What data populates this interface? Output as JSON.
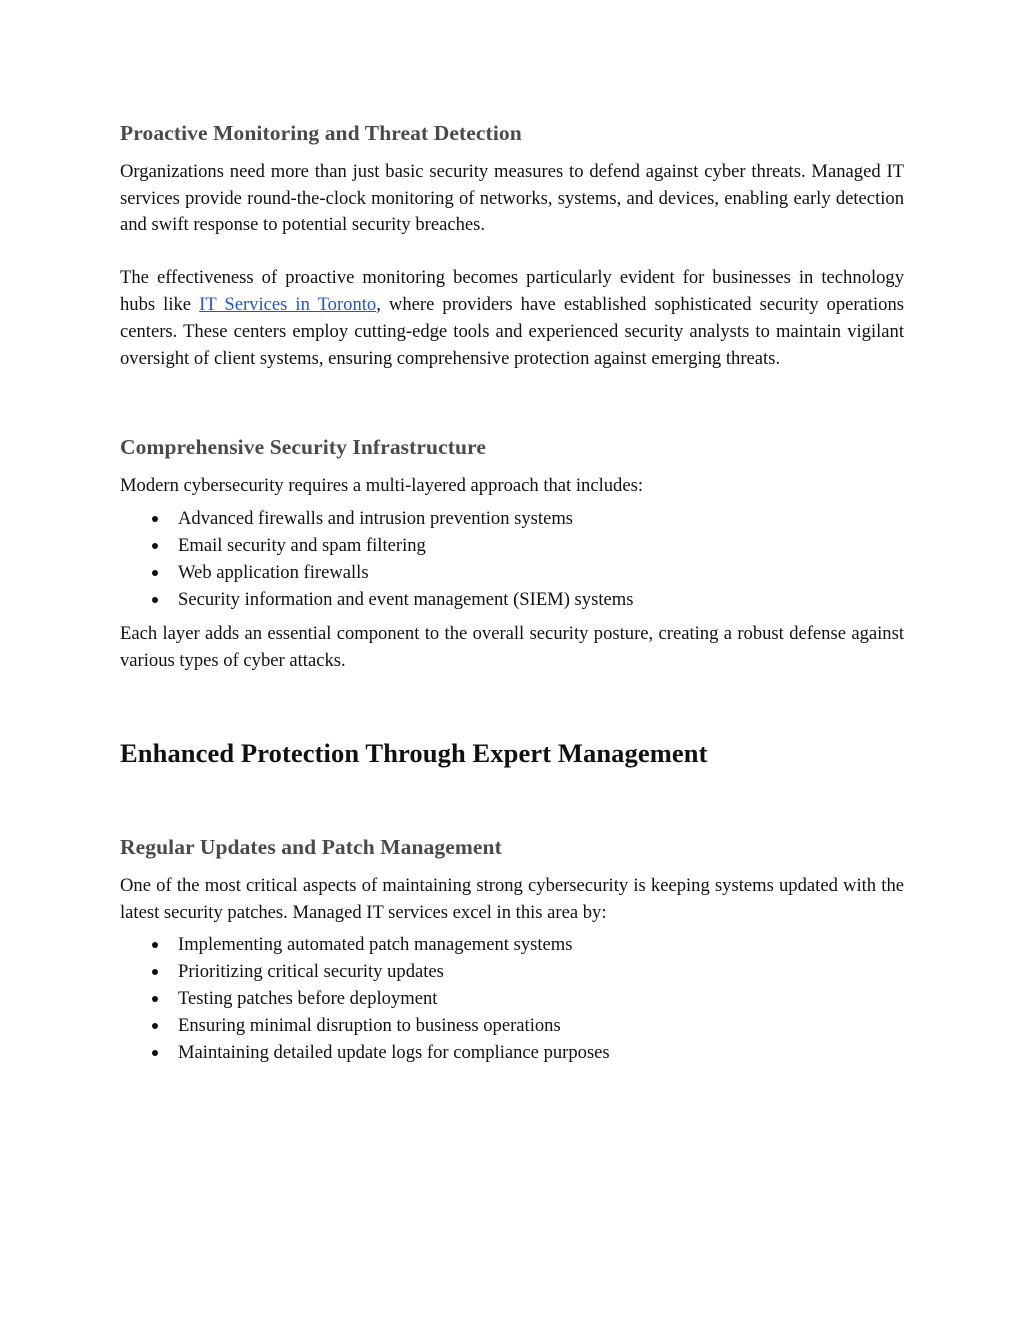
{
  "document": {
    "sections": [
      {
        "heading": "Proactive Monitoring and Threat Detection",
        "paragraph_1": "Organizations need more than just basic security measures to defend against cyber threats. Managed IT services provide round-the-clock monitoring of networks, systems, and devices, enabling early detection and swift response to potential security breaches.",
        "paragraph_2_before_link": "The effectiveness of proactive monitoring becomes particularly evident for businesses in technology hubs like ",
        "link_text": "IT Services in Toronto",
        "paragraph_2_after_link": ", where providers have established sophisticated security operations centers. These centers employ cutting-edge tools and experienced security analysts to maintain vigilant oversight of client systems, ensuring comprehensive protection against emerging threats."
      },
      {
        "heading": "Comprehensive Security Infrastructure",
        "intro": "Modern cybersecurity requires a multi-layered approach that includes:",
        "bullets": [
          "Advanced firewalls and intrusion prevention systems",
          "Email security and spam filtering",
          "Web application firewalls",
          "Security information and event management (SIEM) systems"
        ],
        "closing": "Each layer adds an essential component to the overall security posture, creating a robust defense against various types of cyber attacks."
      }
    ],
    "major_heading": "Enhanced Protection Through Expert Management",
    "sections_after": [
      {
        "heading": "Regular Updates and Patch Management",
        "intro": "One of the most critical aspects of maintaining strong cybersecurity is keeping systems updated with the latest security patches. Managed IT services excel in this area by:",
        "bullets": [
          "Implementing automated patch management systems",
          "Prioritizing critical security updates",
          "Testing patches before deployment",
          "Ensuring minimal disruption to business operations",
          "Maintaining detailed update logs for compliance purposes"
        ]
      }
    ]
  },
  "colors": {
    "heading_gray": "#4a4a4a",
    "body_black": "#111111",
    "link_blue": "#2455c4",
    "page_background": "#ffffff"
  }
}
